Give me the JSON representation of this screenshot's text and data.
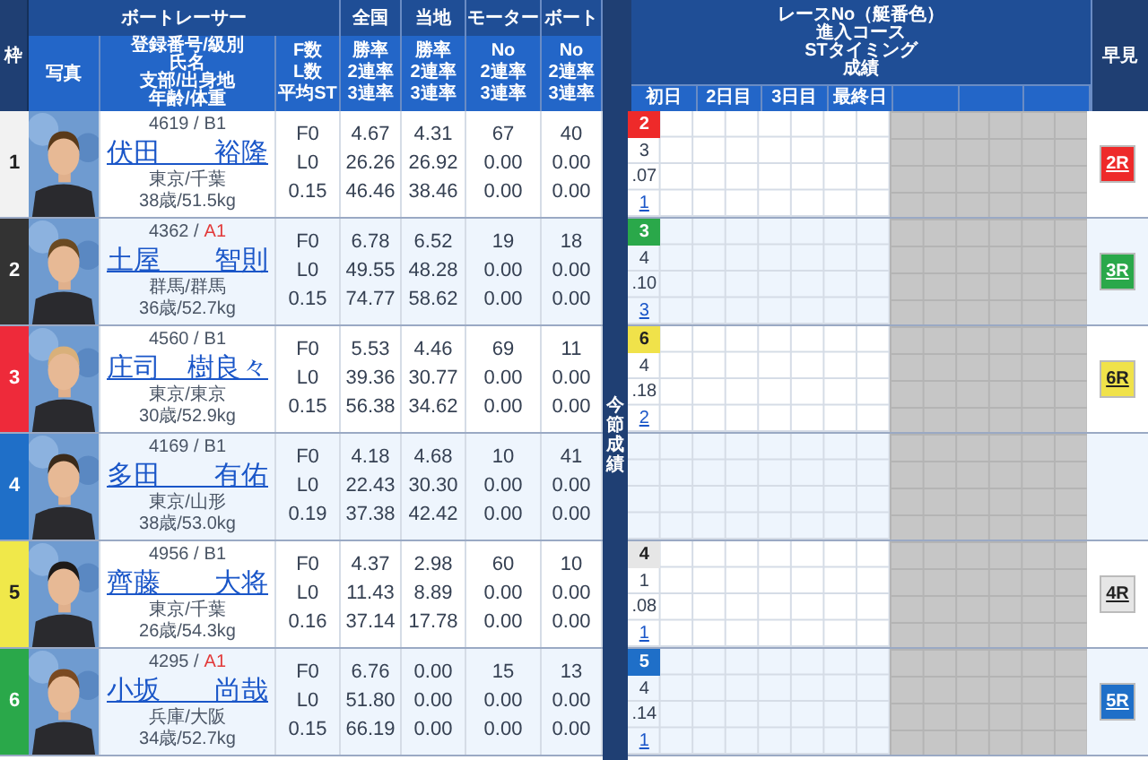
{
  "header": {
    "frame": "枠",
    "racer_group": "ボートレーサー",
    "photo": "写真",
    "profile_lines": [
      "登録番号/級別",
      "氏名",
      "支部/出身地",
      "年齢/体重"
    ],
    "fl_lines": [
      "F数",
      "L数",
      "平均ST"
    ],
    "stat_groups": [
      {
        "title": "全国",
        "lines": [
          "勝率",
          "2連率",
          "3連率"
        ]
      },
      {
        "title": "当地",
        "lines": [
          "勝率",
          "2連率",
          "3連率"
        ]
      },
      {
        "title": "モーター",
        "lines": [
          "No",
          "2連率",
          "3連率"
        ]
      },
      {
        "title": "ボート",
        "lines": [
          "No",
          "2連率",
          "3連率"
        ]
      }
    ],
    "side_label": "今節成績",
    "results_lines": [
      "レースNo（艇番色）",
      "進入コース",
      "STタイミング",
      "成績"
    ],
    "days": [
      "初日",
      "2日目",
      "3日目",
      "最終日"
    ],
    "early": "早見"
  },
  "racers": [
    {
      "frame": "1",
      "color": "#f2f2f2",
      "photo": {
        "kind": "picture"
      },
      "reg_no": "4619 /",
      "class": "B1",
      "class_highlight": false,
      "name": "伏田　　裕隆",
      "branch": "東京/千葉",
      "age_weight": "38歳/51.5kg",
      "fl": [
        "F0",
        "L0",
        "0.15"
      ],
      "national": [
        "4.67",
        "26.26",
        "46.46"
      ],
      "local": [
        "4.31",
        "26.92",
        "38.46"
      ],
      "motor": [
        "67",
        "0.00",
        "0.00"
      ],
      "boat": [
        "40",
        "0.00",
        "0.00"
      ],
      "results": [
        {
          "race_no": "2",
          "color": "#ee2a2a",
          "course": "3",
          "st": ".07",
          "rank": "1"
        }
      ],
      "early": {
        "label": "2R",
        "color": "#ee2a2a"
      }
    },
    {
      "frame": "2",
      "color": "#333333",
      "photo": {
        "kind": "picture"
      },
      "reg_no": "4362 /",
      "class": "A1",
      "class_highlight": true,
      "name": "土屋　　智則",
      "branch": "群馬/群馬",
      "age_weight": "36歳/52.7kg",
      "fl": [
        "F0",
        "L0",
        "0.15"
      ],
      "national": [
        "6.78",
        "49.55",
        "74.77"
      ],
      "local": [
        "6.52",
        "48.28",
        "58.62"
      ],
      "motor": [
        "19",
        "0.00",
        "0.00"
      ],
      "boat": [
        "18",
        "0.00",
        "0.00"
      ],
      "results": [
        {
          "race_no": "3",
          "color": "#2aa84a",
          "course": "4",
          "st": ".10",
          "rank": "3"
        }
      ],
      "early": {
        "label": "3R",
        "color": "#2aa84a"
      }
    },
    {
      "frame": "3",
      "color": "#ee2a3a",
      "photo": {
        "kind": "picture"
      },
      "reg_no": "4560 /",
      "class": "B1",
      "class_highlight": false,
      "name": "庄司　樹良々",
      "branch": "東京/東京",
      "age_weight": "30歳/52.9kg",
      "fl": [
        "F0",
        "L0",
        "0.15"
      ],
      "national": [
        "5.53",
        "39.36",
        "56.38"
      ],
      "local": [
        "4.46",
        "30.77",
        "34.62"
      ],
      "motor": [
        "69",
        "0.00",
        "0.00"
      ],
      "boat": [
        "11",
        "0.00",
        "0.00"
      ],
      "results": [
        {
          "race_no": "6",
          "color": "#f0e24a",
          "course": "4",
          "st": ".18",
          "rank": "2"
        }
      ],
      "early": {
        "label": "6R",
        "color": "#f0e24a"
      }
    },
    {
      "frame": "4",
      "color": "#1f6fc8",
      "photo": {
        "kind": "picture"
      },
      "reg_no": "4169 /",
      "class": "B1",
      "class_highlight": false,
      "name": "多田　　有佑",
      "branch": "東京/山形",
      "age_weight": "38歳/53.0kg",
      "fl": [
        "F0",
        "L0",
        "0.19"
      ],
      "national": [
        "4.18",
        "22.43",
        "37.38"
      ],
      "local": [
        "4.68",
        "30.30",
        "42.42"
      ],
      "motor": [
        "10",
        "0.00",
        "0.00"
      ],
      "boat": [
        "41",
        "0.00",
        "0.00"
      ]
    },
    {
      "frame": "5",
      "color": "#f0e84a",
      "photo": {
        "kind": "picture"
      },
      "reg_no": "4956 /",
      "class": "B1",
      "class_highlight": false,
      "name": "齊藤　　大将",
      "branch": "東京/千葉",
      "age_weight": "26歳/54.3kg",
      "fl": [
        "F0",
        "L0",
        "0.16"
      ],
      "national": [
        "4.37",
        "11.43",
        "37.14"
      ],
      "local": [
        "2.98",
        "8.89",
        "17.78"
      ],
      "motor": [
        "60",
        "0.00",
        "0.00"
      ],
      "boat": [
        "10",
        "0.00",
        "0.00"
      ],
      "results": [
        {
          "race_no": "4",
          "color": "#e6e6e6",
          "course": "1",
          "st": ".08",
          "rank": "1"
        }
      ],
      "early": {
        "label": "4R",
        "color": "#e6e6e6"
      }
    },
    {
      "frame": "6",
      "color": "#2aa84a",
      "photo": {
        "kind": "picture"
      },
      "reg_no": "4295 /",
      "class": "A1",
      "class_highlight": true,
      "name": "小坂　　尚哉",
      "branch": "兵庫/大阪",
      "age_weight": "34歳/52.7kg",
      "fl": [
        "F0",
        "L0",
        "0.15"
      ],
      "national": [
        "6.76",
        "51.80",
        "66.19"
      ],
      "local": [
        "0.00",
        "0.00",
        "0.00"
      ],
      "motor": [
        "15",
        "0.00",
        "0.00"
      ],
      "boat": [
        "13",
        "0.00",
        "0.00"
      ],
      "results": [
        {
          "race_no": "5",
          "color": "#1f6fc8",
          "course": "4",
          "st": ".14",
          "rank": "1"
        }
      ],
      "early": {
        "label": "5R",
        "color": "#1f6fc8"
      }
    }
  ]
}
